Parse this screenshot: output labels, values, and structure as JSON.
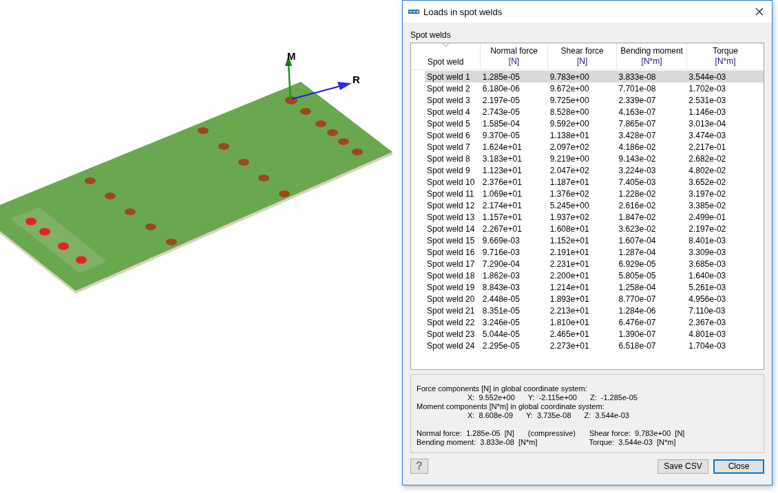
{
  "viewport": {
    "axis_labels": [
      "M",
      "R"
    ]
  },
  "dialog": {
    "title": "Loads in spot welds",
    "group_label": "Spot welds",
    "table": {
      "columns": [
        {
          "title": "Spot weld",
          "sorted": true
        },
        {
          "title": "Normal force",
          "unit": "[N]",
          "sorted": false
        },
        {
          "title": "Shear force",
          "unit": "[N]",
          "sorted": false
        },
        {
          "title": "Bending moment",
          "unit": "[N*m]",
          "sorted": false
        },
        {
          "title": "Torque",
          "unit": "[N*m]",
          "sorted": false
        }
      ],
      "rows": [
        {
          "cells": [
            "Spot weld 1",
            "1.285e-05",
            "9.783e+00",
            "3.833e-08",
            "3.544e-03"
          ],
          "selected": true
        },
        {
          "cells": [
            "Spot weld 2",
            "6.180e-06",
            "9.672e+00",
            "7.701e-08",
            "1.702e-03"
          ],
          "selected": false
        },
        {
          "cells": [
            "Spot weld 3",
            "2.197e-05",
            "9.725e+00",
            "2.339e-07",
            "2.531e-03"
          ],
          "selected": false
        },
        {
          "cells": [
            "Spot weld 4",
            "2.743e-05",
            "8.528e+00",
            "4.163e-07",
            "1.146e-03"
          ],
          "selected": false
        },
        {
          "cells": [
            "Spot weld 5",
            "1.585e-04",
            "9.592e+00",
            "7.865e-07",
            "3.013e-04"
          ],
          "selected": false
        },
        {
          "cells": [
            "Spot weld 6",
            "9.370e-05",
            "1.138e+01",
            "3.428e-07",
            "3.474e-03"
          ],
          "selected": false
        },
        {
          "cells": [
            "Spot weld 7",
            "1.624e+01",
            "2.097e+02",
            "4.186e-02",
            "2.217e-01"
          ],
          "selected": false
        },
        {
          "cells": [
            "Spot weld 8",
            "3.183e+01",
            "9.219e+00",
            "9.143e-02",
            "2.682e-02"
          ],
          "selected": false
        },
        {
          "cells": [
            "Spot weld 9",
            "1.123e+01",
            "2.047e+02",
            "3.224e-03",
            "4.802e-02"
          ],
          "selected": false
        },
        {
          "cells": [
            "Spot weld 10",
            "2.376e+01",
            "1.187e+01",
            "7.405e-03",
            "3.652e-02"
          ],
          "selected": false
        },
        {
          "cells": [
            "Spot weld 11",
            "1.069e+01",
            "1.376e+02",
            "1.228e-02",
            "3.197e-02"
          ],
          "selected": false
        },
        {
          "cells": [
            "Spot weld 12",
            "2.174e+01",
            "5.245e+00",
            "2.616e-02",
            "3.385e-02"
          ],
          "selected": false
        },
        {
          "cells": [
            "Spot weld 13",
            "1.157e+01",
            "1.937e+02",
            "1.847e-02",
            "2.499e-01"
          ],
          "selected": false
        },
        {
          "cells": [
            "Spot weld 14",
            "2.267e+01",
            "1.608e+01",
            "3.623e-02",
            "2.197e-02"
          ],
          "selected": false
        },
        {
          "cells": [
            "Spot weld 15",
            "9.669e-03",
            "1.152e+01",
            "1.607e-04",
            "8.401e-03"
          ],
          "selected": false
        },
        {
          "cells": [
            "Spot weld 16",
            "9.716e-03",
            "2.191e+01",
            "1.287e-04",
            "3.309e-03"
          ],
          "selected": false
        },
        {
          "cells": [
            "Spot weld 17",
            "7.290e-04",
            "2.231e+01",
            "6.929e-05",
            "3.685e-03"
          ],
          "selected": false
        },
        {
          "cells": [
            "Spot weld 18",
            "1.862e-03",
            "2.200e+01",
            "5.805e-05",
            "1.640e-03"
          ],
          "selected": false
        },
        {
          "cells": [
            "Spot weld 19",
            "8.843e-03",
            "1.214e+01",
            "1.258e-04",
            "5.261e-03"
          ],
          "selected": false
        },
        {
          "cells": [
            "Spot weld 20",
            "2.448e-05",
            "1.893e+01",
            "8.770e-07",
            "4.956e-03"
          ],
          "selected": false
        },
        {
          "cells": [
            "Spot weld 21",
            "8.351e-05",
            "2.213e+01",
            "1.284e-06",
            "7.110e-03"
          ],
          "selected": false
        },
        {
          "cells": [
            "Spot weld 22",
            "3.246e-05",
            "1.810e+01",
            "6.476e-07",
            "2.367e-03"
          ],
          "selected": false
        },
        {
          "cells": [
            "Spot weld 23",
            "5.044e-05",
            "2.465e+01",
            "1.390e-07",
            "4.801e-03"
          ],
          "selected": false
        },
        {
          "cells": [
            "Spot weld 24",
            "2.295e-05",
            "2.273e+01",
            "6.518e-07",
            "1.704e-03"
          ],
          "selected": false
        }
      ]
    },
    "details": {
      "force_heading": "Force components [N] in global coordinate system:",
      "force_values": [
        "X:  9.552e+00",
        "Y:  -2.115e+00",
        "Z:  -1.285e-05"
      ],
      "moment_heading": "Moment components [N*m] in global coordinate system:",
      "moment_values": [
        "X:  8.608e-09",
        "Y:  3.735e-08",
        "Z:  3.544e-03"
      ],
      "summary_rows": [
        [
          "Normal force:  1.285e-05  [N]",
          "(compressive)",
          "Shear force:  9.783e+00  [N]"
        ],
        [
          "Bending moment:  3.833e-08  [N*m]",
          "Torque:  3.544e-03  [N*m]"
        ]
      ]
    },
    "help_button": "?",
    "buttons": [
      {
        "label": "Save CSV",
        "default": false
      },
      {
        "label": "Close",
        "default": true
      }
    ]
  }
}
